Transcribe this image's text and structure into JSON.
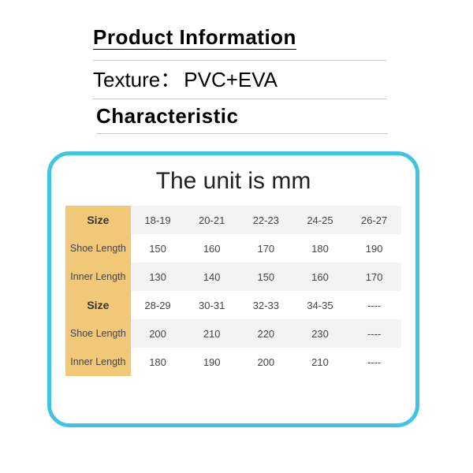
{
  "header": {
    "title": "Product Information",
    "texture_label": "Texture：",
    "texture_value": "PVC+EVA",
    "characteristic_label": "Characteristic"
  },
  "card": {
    "title": "The unit is mm"
  },
  "chart_data": {
    "type": "table",
    "unit": "mm",
    "row_labels": [
      "Size",
      "Shoe Length",
      "Inner Length",
      "Size",
      "Shoe Length",
      "Inner Length"
    ],
    "rows": [
      [
        "18-19",
        "20-21",
        "22-23",
        "24-25",
        "26-27"
      ],
      [
        "150",
        "160",
        "170",
        "180",
        "190"
      ],
      [
        "130",
        "140",
        "150",
        "160",
        "170"
      ],
      [
        "28-29",
        "30-31",
        "32-33",
        "34-35",
        "----"
      ],
      [
        "200",
        "210",
        "220",
        "230",
        "----"
      ],
      [
        "180",
        "190",
        "200",
        "210",
        "----"
      ]
    ]
  }
}
